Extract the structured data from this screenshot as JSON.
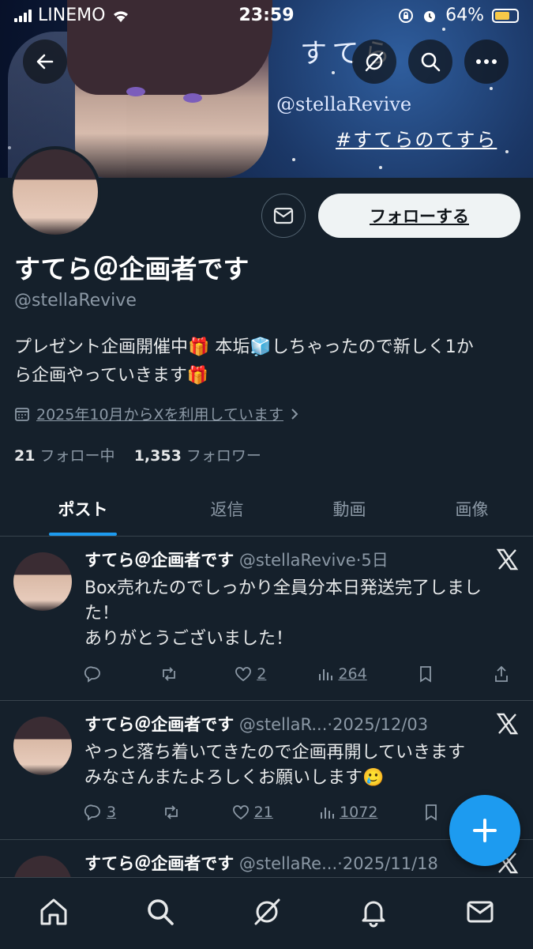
{
  "status_bar": {
    "carrier": "LINEMO",
    "time": "23:59",
    "battery": "64%"
  },
  "banner": {
    "title": "すてら",
    "handle": "@stellaRevive",
    "hashtag": "#すてらのてすら"
  },
  "profile": {
    "display_name": "すてら＠企画者です",
    "handle": "@stellaRevive",
    "bio_line1": "プレゼント企画開催中🎁 本垢🧊しちゃったので新しく1か",
    "bio_line2": "ら企画やっていきます🎁",
    "joined": "2025年10月からXを利用しています",
    "following_count": "21",
    "following_label": "フォロー中",
    "followers_count": "1,353",
    "followers_label": "フォロワー",
    "follow_label": "フォローする"
  },
  "tabs": [
    {
      "label": "ポスト",
      "active": true
    },
    {
      "label": "返信"
    },
    {
      "label": "動画"
    },
    {
      "label": "画像"
    }
  ],
  "posts": [
    {
      "name": "すてら＠企画者です",
      "handle": "@stellaRevive",
      "time": "5日",
      "text_lines": [
        "Box売れたのでしっかり全員分本日発送完了しまし",
        "た！",
        "ありがとうございました！"
      ],
      "replies": "",
      "reposts": "",
      "likes": "2",
      "views": "264"
    },
    {
      "name": "すてら＠企画者です",
      "handle": "@stellaR...",
      "time": "2025/12/03",
      "text_lines": [
        "やっと落ち着いてきたので企画再開していきます",
        "みなさんまたよろしくお願いします🥲"
      ],
      "replies": "3",
      "reposts": "",
      "likes": "21",
      "views": "1072"
    },
    {
      "name": "すてら＠企画者です",
      "handle": "@stellaRe...",
      "time": "2025/11/18",
      "text_lines": [],
      "replies": "",
      "reposts": "",
      "likes": "",
      "views": ""
    }
  ],
  "colors": {
    "background": "#15202b",
    "accent": "#1d9bf0",
    "muted": "#8b98a5"
  }
}
